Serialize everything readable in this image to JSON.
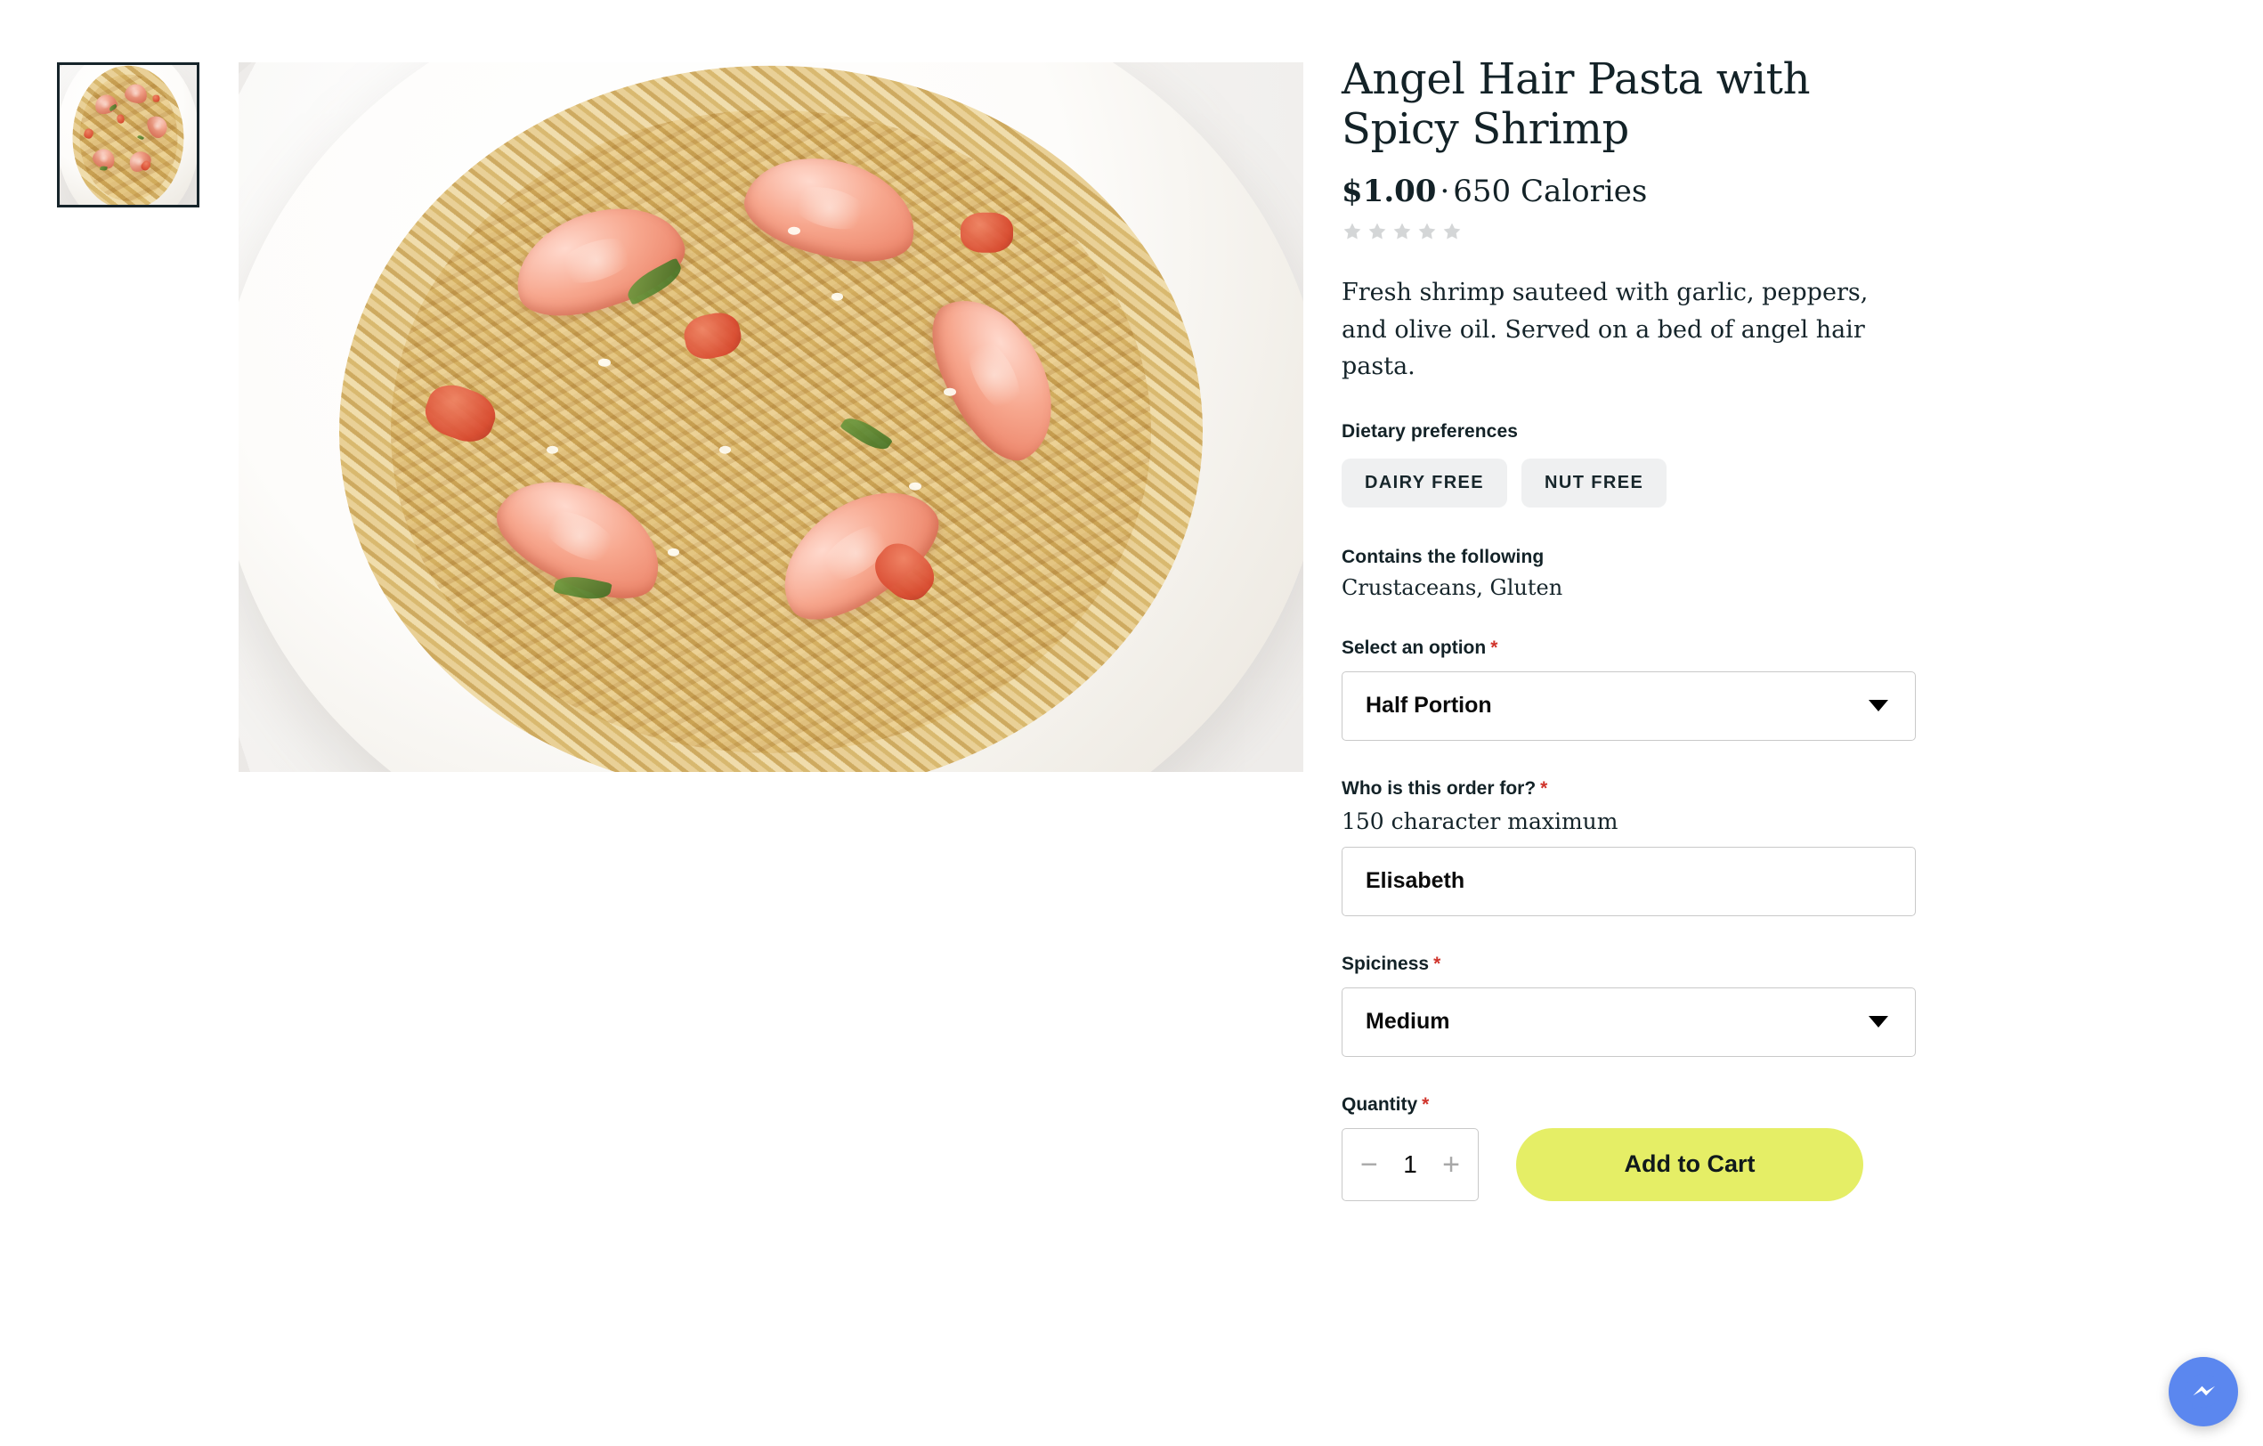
{
  "product": {
    "title": "Angel Hair Pasta with Spicy Shrimp",
    "price": "$1.00",
    "separator": "·",
    "calories": "650 Calories",
    "rating_stars": 5,
    "rating_filled": 0,
    "description": "Fresh shrimp sauteed with garlic, peppers, and olive oil. Served on a bed of angel hair pasta."
  },
  "gallery": {
    "thumbnail_alt": "Angel hair pasta with shrimp thumbnail",
    "hero_alt": "Bowl of angel hair pasta with spicy shrimp on marble"
  },
  "dietary": {
    "heading": "Dietary preferences",
    "tags": [
      "DAIRY FREE",
      "NUT FREE"
    ]
  },
  "allergens": {
    "heading": "Contains the following",
    "values": "Crustaceans, Gluten"
  },
  "form": {
    "option": {
      "label": "Select an option",
      "required_marker": "*",
      "value": "Half Portion"
    },
    "order_for": {
      "label": "Who is this order for?",
      "required_marker": "*",
      "hint": "150 character maximum",
      "value": "Elisabeth",
      "placeholder": ""
    },
    "spiciness": {
      "label": "Spiciness",
      "required_marker": "*",
      "value": "Medium"
    },
    "quantity": {
      "label": "Quantity",
      "required_marker": "*",
      "value": "1",
      "decrease_label": "−",
      "increase_label": "+"
    },
    "submit_label": "Add to Cart"
  },
  "widgets": {
    "messenger_icon": "messenger-icon"
  },
  "colors": {
    "accent_button": "#e5ee66",
    "required_asterisk": "#d0342c",
    "chip_background": "#eff0f1",
    "text_primary": "#132227",
    "star_empty": "#d4d6d7",
    "messenger_blue": "#5b87ef"
  }
}
